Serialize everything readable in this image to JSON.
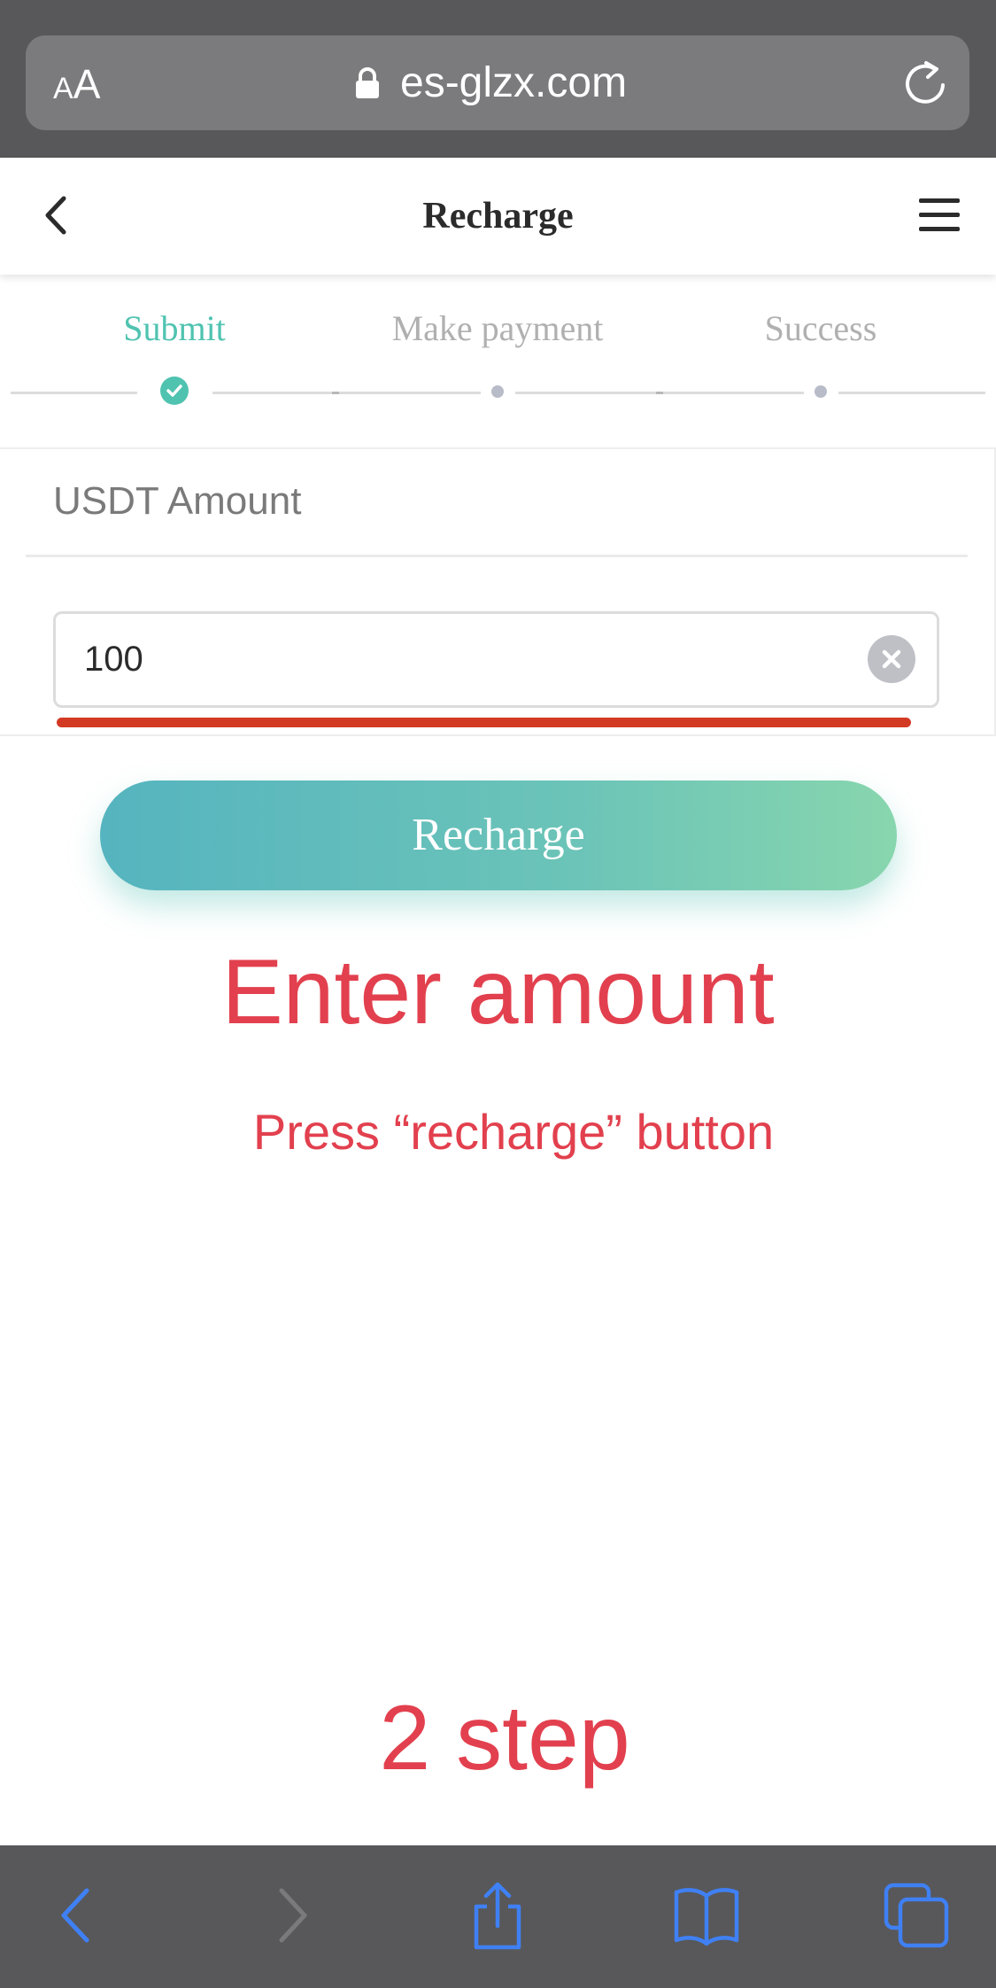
{
  "browser": {
    "text_size_label": "AA",
    "url": "es-glzx.com"
  },
  "header": {
    "title": "Recharge"
  },
  "steps": [
    {
      "label": "Submit",
      "state": "completed"
    },
    {
      "label": "Make payment",
      "state": "pending"
    },
    {
      "label": "Success",
      "state": "pending"
    }
  ],
  "form": {
    "amount_label": "USDT Amount",
    "amount_value": "100"
  },
  "recharge_button": {
    "label": "Recharge"
  },
  "annotations": {
    "main": "Enter amount",
    "sub": "Press “recharge” button",
    "step": "2 step"
  },
  "colors": {
    "accent": "#4fc3b0",
    "annotation": "#e2404e",
    "underline": "#d23a24",
    "inactive": "#b0b0b0",
    "browser_chrome": "#58585a",
    "browser_icon": "#3f80f4"
  },
  "icons": {
    "lock": "lock-icon",
    "reload": "reload-icon",
    "back": "chevron-left-icon",
    "menu": "hamburger-menu-icon",
    "check": "check-icon",
    "clear": "clear-icon",
    "nav_back": "browser-back-icon",
    "nav_forward": "browser-forward-icon",
    "share": "share-icon",
    "bookmarks": "bookmarks-icon",
    "tabs": "tabs-icon"
  }
}
